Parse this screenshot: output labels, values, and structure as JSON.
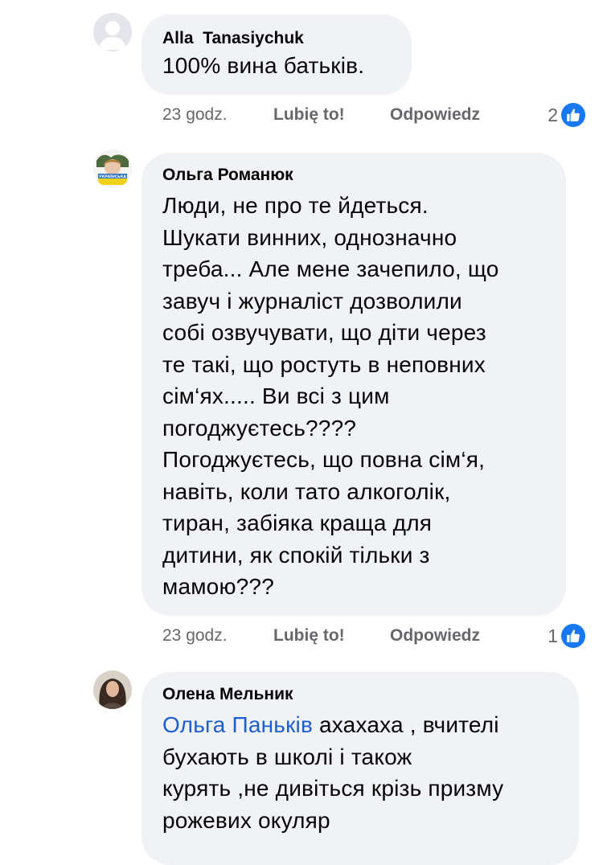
{
  "comments": [
    {
      "author": "Alla  Tanasiychuk",
      "text": "100% вина батьків.",
      "time": "23 godz.",
      "like_label": "Lubię to!",
      "reply_label": "Odpowiedz",
      "reaction_count": "2",
      "avatar": "default-profile-icon"
    },
    {
      "author": "Ольга Романюк",
      "text_lines": [
        "Люди, не про те йдеться.",
        "Шукати винних, однозначно",
        "треба... Але мене зачепило, що",
        "завуч і журналіст дозволили",
        "собі озвучувати, що діти через",
        "те такі, що ростуть в неповних",
        "сім‘ях..... Ви всі з цим",
        "погоджуєтесь????",
        "Погоджуєтесь, що повна сім‘я,",
        "навіть, коли тато алкоголік,",
        "тиран, забіяка краща для",
        "дитини, як спокій тільки з",
        "мамою???"
      ],
      "avatar_badge_text": "УКРАЇНСЬКА",
      "time": "23 godz.",
      "like_label": "Lubię to!",
      "reply_label": "Odpowiedz",
      "reaction_count": "1",
      "avatar": "profile-photo"
    },
    {
      "author": "Олена Мельник",
      "mention": "Ольга Паньків",
      "text_first": " ахахаха , вчителі",
      "text_lines": [
        "бухають в школі і також",
        "курять ,не дивіться крізь призму",
        "рожевих окуляр"
      ],
      "avatar": "profile-photo"
    }
  ],
  "colors": {
    "bubble": "#f0f2f5",
    "meta_text": "#65676b",
    "mention": "#1c5fd0",
    "like_badge": "#1877f2"
  }
}
